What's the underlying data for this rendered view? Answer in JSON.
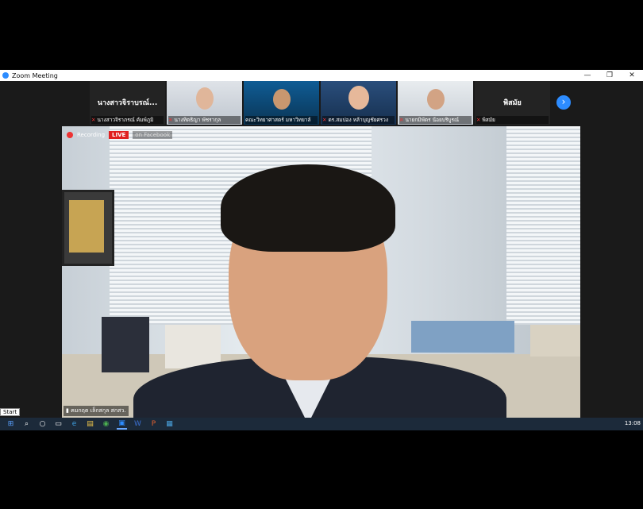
{
  "window": {
    "title": "Zoom Meeting",
    "controls": [
      "—",
      "❐",
      "✕"
    ]
  },
  "participants": [
    {
      "big_name": "นางสาวจิราบรณ์...",
      "caption": "นางสาวจิราภรณ์ คัมพ์ภูมิ",
      "type": "name"
    },
    {
      "caption": "นางทิตธิญา พัชรากุล",
      "type": "video",
      "tint": "p1"
    },
    {
      "caption": "คณะวิทยาศาสตร์ มหาวิทยาลั",
      "type": "video",
      "tint": "p2"
    },
    {
      "caption": "ดร.สมปอง หล้าบุญชัยศรวง",
      "type": "video",
      "tint": "p3"
    },
    {
      "caption": "นายกมิพัตร น้อยบริบูรณ์",
      "type": "video",
      "tint": "p4"
    },
    {
      "big_name": "พิสมัย",
      "caption": "พิสมัย",
      "type": "name"
    }
  ],
  "next_icon": "›",
  "main_video": {
    "recording_label": "Recording",
    "live_label": "LIVE",
    "stream_label": "on Facebook",
    "speaker_name": "คมกฤต เล็กสกุล สกสว."
  },
  "taskbar": {
    "start_tooltip": "Start",
    "icons": [
      "windows-icon",
      "search-icon",
      "cortana-icon",
      "taskview-icon",
      "edge-icon",
      "explorer-icon",
      "chrome-icon",
      "zoom-icon",
      "word-icon",
      "powerpoint-icon",
      "app-icon"
    ],
    "clock": "13:08"
  }
}
